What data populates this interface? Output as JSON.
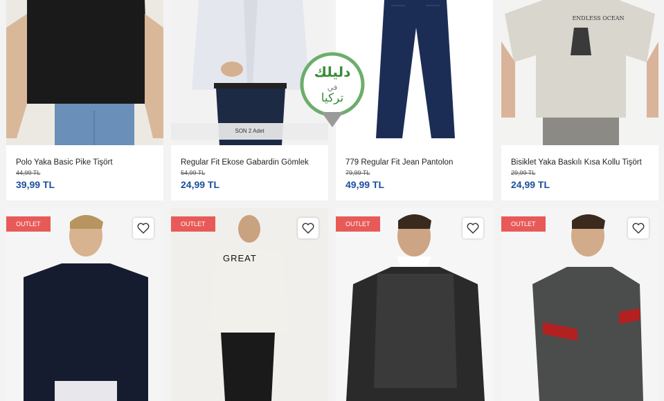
{
  "products_row1": [
    {
      "name": "Polo Yaka Basic Pike Tişört",
      "old_price": "44,99 TL",
      "new_price": "39,99 TL"
    },
    {
      "name": "Regular Fit Ekose Gabardin Gömlek",
      "old_price": "54,99 TL",
      "new_price": "24,99 TL",
      "stock_badge": "SON 2 Adet"
    },
    {
      "name": "779 Regular Fit Jean Pantolon",
      "old_price": "79,99 TL",
      "new_price": "49,99 TL"
    },
    {
      "name": "Bisiklet Yaka Baskılı Kısa Kollu Tişört",
      "old_price": "29,99 TL",
      "new_price": "24,99 TL"
    }
  ],
  "products_row2": [
    {
      "badge": "OUTLET"
    },
    {
      "badge": "OUTLET",
      "shirt_text": "GREAT"
    },
    {
      "badge": "OUTLET"
    },
    {
      "badge": "OUTLET"
    }
  ],
  "watermark": {
    "line1": "دليلك",
    "line2": "في",
    "line3": "تركيا"
  },
  "tshirt_print": "ENDLESS OCEAN",
  "colors": {
    "price": "#1b4f9c",
    "outlet": "#e85a58",
    "brand_green": "#3a8a3a"
  },
  "icons": {
    "favorite": "heart-icon"
  }
}
